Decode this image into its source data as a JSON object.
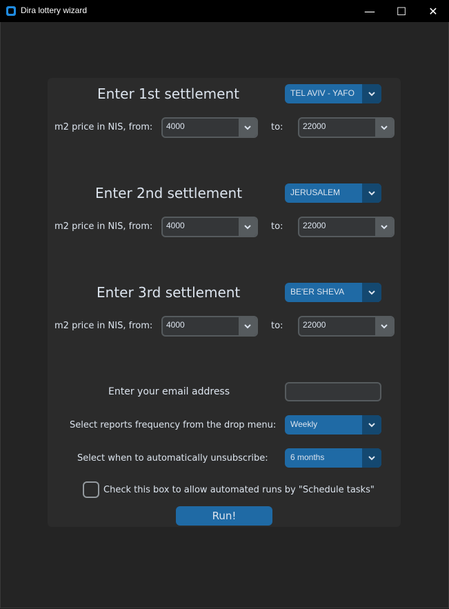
{
  "window": {
    "title": "Dira lottery wizard",
    "minimize_glyph": "—",
    "maximize_glyph": "☐",
    "close_glyph": "✕"
  },
  "settlements": [
    {
      "heading": "Enter 1st settlement",
      "selected": "TEL AVIV - YAFO",
      "from_label": "m2 price in NIS, from:",
      "from_value": "4000",
      "to_label": "to:",
      "to_value": "22000"
    },
    {
      "heading": "Enter 2nd settlement",
      "selected": "JERUSALEM",
      "from_label": "m2 price in NIS, from:",
      "from_value": "4000",
      "to_label": "to:",
      "to_value": "22000"
    },
    {
      "heading": "Enter 3rd settlement",
      "selected": "BE'ER SHEVA",
      "from_label": "m2 price in NIS, from:",
      "from_value": "4000",
      "to_label": "to:",
      "to_value": "22000"
    }
  ],
  "email": {
    "label": "Enter your email address",
    "value": ""
  },
  "frequency": {
    "label": "Select reports frequency from the drop menu:",
    "selected": "Weekly"
  },
  "unsubscribe": {
    "label": "Select when to automatically unsubscribe:",
    "selected": "6 months"
  },
  "schedule": {
    "label": "Check this box to allow automated runs by \"Schedule tasks\"",
    "checked": false
  },
  "run_button": "Run!",
  "colors": {
    "accent": "#1f6aa5",
    "accent_dark": "#144870",
    "panel": "#2b2b2b",
    "background": "#242424",
    "text": "#dce4ee"
  }
}
